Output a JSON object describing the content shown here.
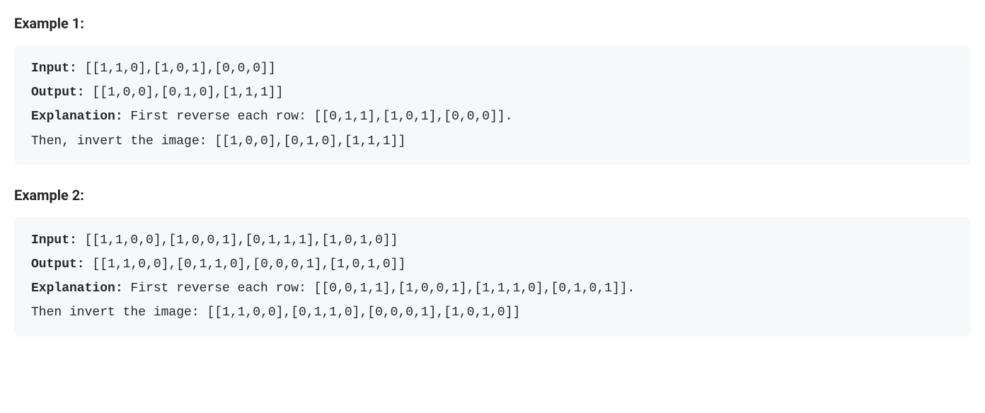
{
  "examples": [
    {
      "heading": "Example 1:",
      "input_label": "Input:",
      "input_value": " [[1,1,0],[1,0,1],[0,0,0]]",
      "output_label": "Output:",
      "output_value": " [[1,0,0],[0,1,0],[1,1,1]]",
      "explanation_label": "Explanation:",
      "explanation_line1": " First reverse each row: [[0,1,1],[1,0,1],[0,0,0]].",
      "explanation_line2": "Then, invert the image: [[1,0,0],[0,1,0],[1,1,1]]"
    },
    {
      "heading": "Example 2:",
      "input_label": "Input:",
      "input_value": " [[1,1,0,0],[1,0,0,1],[0,1,1,1],[1,0,1,0]]",
      "output_label": "Output:",
      "output_value": " [[1,1,0,0],[0,1,1,0],[0,0,0,1],[1,0,1,0]]",
      "explanation_label": "Explanation:",
      "explanation_line1": " First reverse each row: [[0,0,1,1],[1,0,0,1],[1,1,1,0],[0,1,0,1]].",
      "explanation_line2": "Then invert the image: [[1,1,0,0],[0,1,1,0],[0,0,0,1],[1,0,1,0]]"
    }
  ]
}
